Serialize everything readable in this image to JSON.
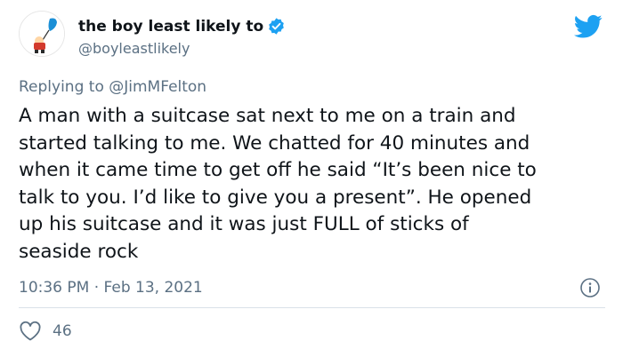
{
  "author": {
    "display_name": "the boy least likely to",
    "handle": "@boyleastlikely",
    "verified_icon": "verified-badge-icon",
    "avatar_icon": "avatar-cartoon-icon"
  },
  "reply": {
    "label": "Replying to",
    "mention": "@JimMFelton"
  },
  "tweet": {
    "lines": [
      "A man with a suitcase sat next to me on a train and",
      "started talking to me. We chatted for 40 minutes and",
      "when it came time to get off he said “It’s been nice to",
      "talk to you. I’d like to give you a present”. He opened",
      "up his suitcase and it was just FULL of sticks of",
      "seaside rock"
    ],
    "timestamp": "10:36 PM · Feb 13, 2021"
  },
  "engagement": {
    "likes": "46",
    "like_icon": "heart-icon"
  },
  "icons": {
    "brand": "twitter-bird-icon",
    "info": "info-icon"
  },
  "colors": {
    "twitter_blue": "#1da1f2",
    "secondary_text": "#5b7083",
    "primary_text": "#0f1419",
    "divider": "#d9e1e8"
  }
}
